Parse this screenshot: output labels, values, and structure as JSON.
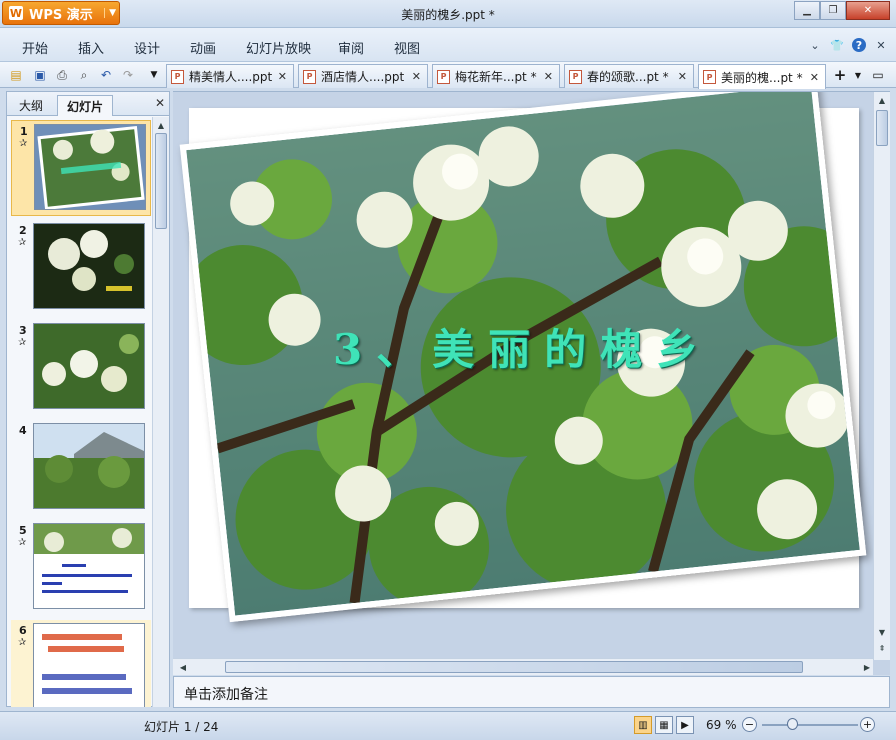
{
  "app": {
    "name": "WPS 演示",
    "logo_letter": "W",
    "window_title": "美丽的槐乡.ppt *"
  },
  "menu": [
    "开始",
    "插入",
    "设计",
    "动画",
    "幻灯片放映",
    "审阅",
    "视图"
  ],
  "tabs": [
    {
      "label": "精美情人....ppt"
    },
    {
      "label": "酒店情人....ppt"
    },
    {
      "label": "梅花新年...pt *"
    },
    {
      "label": "春的颂歌...pt *"
    },
    {
      "label": "美丽的槐...pt *",
      "active": true
    }
  ],
  "panel": {
    "tab_outline": "大纲",
    "tab_slides": "幻灯片"
  },
  "thumbnails": [
    {
      "num": "1",
      "star": "✰",
      "selected": true
    },
    {
      "num": "2",
      "star": "✰"
    },
    {
      "num": "3",
      "star": "✰"
    },
    {
      "num": "4",
      "star": ""
    },
    {
      "num": "5",
      "star": "✰"
    },
    {
      "num": "6",
      "star": "✰"
    }
  ],
  "slide": {
    "title": "3、美丽的槐乡"
  },
  "notes": {
    "placeholder": "单击添加备注"
  },
  "status": {
    "slide_indicator": "幻灯片 1 / 24",
    "zoom": "69 %"
  },
  "colors": {
    "accent": "#e8720c",
    "title_text": "#3fe3b8"
  }
}
